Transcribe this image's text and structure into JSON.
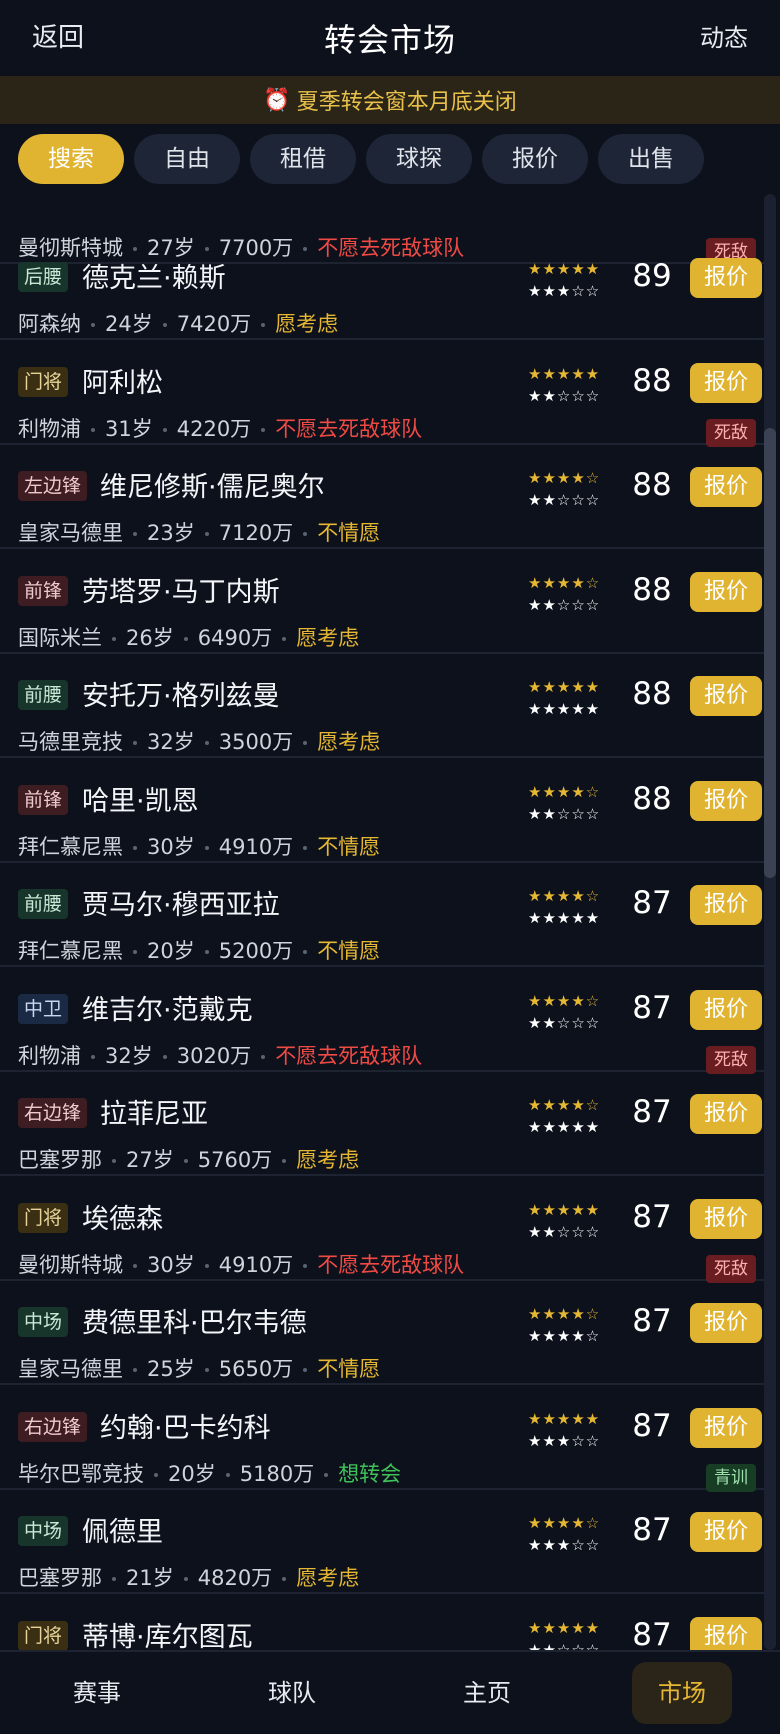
{
  "header": {
    "back": "返回",
    "title": "转会市场",
    "news": "动态"
  },
  "banner": {
    "icon": "alarm-clock-icon",
    "text": "夏季转会窗本月底关闭"
  },
  "tabs": [
    "搜索",
    "自由",
    "租借",
    "球探",
    "报价",
    "出售"
  ],
  "offer_label": "报价",
  "partial_row": {
    "club": "曼彻斯特城",
    "age": "27岁",
    "value": "7700万",
    "status": "不愿去死敌球队",
    "flag": "死敌"
  },
  "players": [
    {
      "pos": "后腰",
      "name": "德克兰·赖斯",
      "club": "阿森纳",
      "age": "24岁",
      "value": "7420万",
      "status": "愿考虑",
      "stars_top": "★★★★★",
      "stars_bottom": "★★★☆☆",
      "rating": "89",
      "flag": ""
    },
    {
      "pos": "门将",
      "name": "阿利松",
      "club": "利物浦",
      "age": "31岁",
      "value": "4220万",
      "status": "不愿去死敌球队",
      "stars_top": "★★★★★",
      "stars_bottom": "★★☆☆☆",
      "rating": "88",
      "flag": "死敌"
    },
    {
      "pos": "左边锋",
      "name": "维尼修斯·儒尼奥尔",
      "club": "皇家马德里",
      "age": "23岁",
      "value": "7120万",
      "status": "不情愿",
      "stars_top": "★★★★☆",
      "stars_bottom": "★★☆☆☆",
      "rating": "88",
      "flag": ""
    },
    {
      "pos": "前锋",
      "name": "劳塔罗·马丁内斯",
      "club": "国际米兰",
      "age": "26岁",
      "value": "6490万",
      "status": "愿考虑",
      "stars_top": "★★★★☆",
      "stars_bottom": "★★☆☆☆",
      "rating": "88",
      "flag": ""
    },
    {
      "pos": "前腰",
      "name": "安托万·格列兹曼",
      "club": "马德里竞技",
      "age": "32岁",
      "value": "3500万",
      "status": "愿考虑",
      "stars_top": "★★★★★",
      "stars_bottom": "★★★★★",
      "rating": "88",
      "flag": ""
    },
    {
      "pos": "前锋",
      "name": "哈里·凯恩",
      "club": "拜仁慕尼黑",
      "age": "30岁",
      "value": "4910万",
      "status": "不情愿",
      "stars_top": "★★★★☆",
      "stars_bottom": "★★☆☆☆",
      "rating": "88",
      "flag": ""
    },
    {
      "pos": "前腰",
      "name": "贾马尔·穆西亚拉",
      "club": "拜仁慕尼黑",
      "age": "20岁",
      "value": "5200万",
      "status": "不情愿",
      "stars_top": "★★★★☆",
      "stars_bottom": "★★★★★",
      "rating": "87",
      "flag": ""
    },
    {
      "pos": "中卫",
      "name": "维吉尔·范戴克",
      "club": "利物浦",
      "age": "32岁",
      "value": "3020万",
      "status": "不愿去死敌球队",
      "stars_top": "★★★★☆",
      "stars_bottom": "★★☆☆☆",
      "rating": "87",
      "flag": "死敌"
    },
    {
      "pos": "右边锋",
      "name": "拉菲尼亚",
      "club": "巴塞罗那",
      "age": "27岁",
      "value": "5760万",
      "status": "愿考虑",
      "stars_top": "★★★★☆",
      "stars_bottom": "★★★★★",
      "rating": "87",
      "flag": ""
    },
    {
      "pos": "门将",
      "name": "埃德森",
      "club": "曼彻斯特城",
      "age": "30岁",
      "value": "4910万",
      "status": "不愿去死敌球队",
      "stars_top": "★★★★★",
      "stars_bottom": "★★☆☆☆",
      "rating": "87",
      "flag": "死敌"
    },
    {
      "pos": "中场",
      "name": "费德里科·巴尔韦德",
      "club": "皇家马德里",
      "age": "25岁",
      "value": "5650万",
      "status": "不情愿",
      "stars_top": "★★★★☆",
      "stars_bottom": "★★★★☆",
      "rating": "87",
      "flag": ""
    },
    {
      "pos": "右边锋",
      "name": "约翰·巴卡约科",
      "club": "毕尔巴鄂竞技",
      "age": "20岁",
      "value": "5180万",
      "status": "想转会",
      "stars_top": "★★★★★",
      "stars_bottom": "★★★☆☆",
      "rating": "87",
      "flag": "青训"
    },
    {
      "pos": "中场",
      "name": "佩德里",
      "club": "巴塞罗那",
      "age": "21岁",
      "value": "4820万",
      "status": "愿考虑",
      "stars_top": "★★★★☆",
      "stars_bottom": "★★★☆☆",
      "rating": "87",
      "flag": ""
    },
    {
      "pos": "门将",
      "name": "蒂博·库尔图瓦",
      "club": "",
      "age": "",
      "value": "",
      "status": "",
      "stars_top": "★★★★★",
      "stars_bottom": "★★☆☆☆",
      "rating": "87",
      "flag": ""
    }
  ],
  "bottom_nav": [
    "赛事",
    "球队",
    "主页",
    "市场"
  ],
  "colors": {
    "accent": "#e0b431",
    "bg": "#0c111b",
    "rival": "#f04a45",
    "green": "#3fc25a"
  }
}
